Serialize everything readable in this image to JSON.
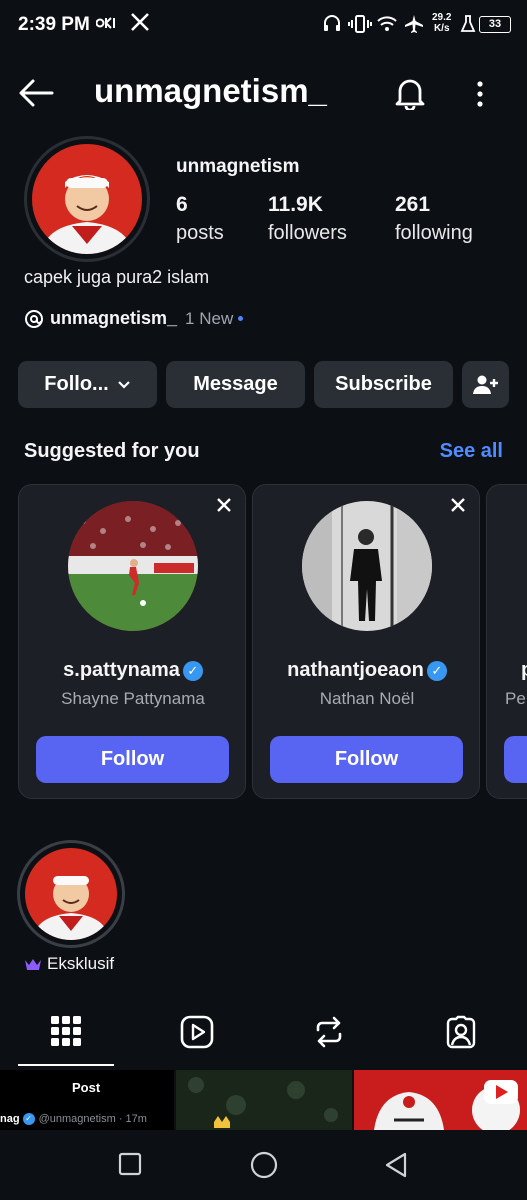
{
  "status_bar": {
    "time": "2:39 PM",
    "net_speed_value": "29.2",
    "net_speed_unit": "K/s",
    "battery": "33",
    "icons": [
      "x-logo-icon",
      "headset-icon",
      "vibrate-icon",
      "wifi-icon",
      "airplane-icon",
      "flask-icon",
      "battery-icon"
    ]
  },
  "header": {
    "username": "unmagnetism_",
    "back_icon": "arrow-left-icon",
    "bell_icon": "bell-icon",
    "more_icon": "more-vertical-icon"
  },
  "profile": {
    "display_name": "unmagnetism",
    "stats": [
      {
        "value": "6",
        "label": "posts"
      },
      {
        "value": "11.9K",
        "label": "followers"
      },
      {
        "value": "261",
        "label": "following"
      }
    ],
    "bio": "capek juga pura2 islam",
    "threads": {
      "handle": "unmagnetism_",
      "new_text": "1 New"
    }
  },
  "actions": {
    "following": "Follo...",
    "message": "Message",
    "subscribe": "Subscribe"
  },
  "suggested": {
    "title": "Suggested for you",
    "see_all": "See all",
    "cards": [
      {
        "username": "s.pattynama",
        "full_name": "Shayne Pattynama",
        "follow": "Follow"
      },
      {
        "username": "nathantjoeaon",
        "full_name": "Nathan Noël",
        "follow": "Follow"
      },
      {
        "username": "p",
        "full_name": "Pe"
      }
    ]
  },
  "highlight": {
    "label": "Eksklusif"
  },
  "tabs": [
    "grid-icon",
    "reels-icon",
    "repost-icon",
    "tagged-icon"
  ],
  "grid_preview": {
    "post_label": "Post",
    "post_meta": "nag",
    "post_handle": "@unmagnetism · 17m"
  },
  "colors": {
    "background": "#0c0f14",
    "accent": "#4f8cff",
    "follow_button": "#5865f2",
    "verified": "#3897f0"
  }
}
